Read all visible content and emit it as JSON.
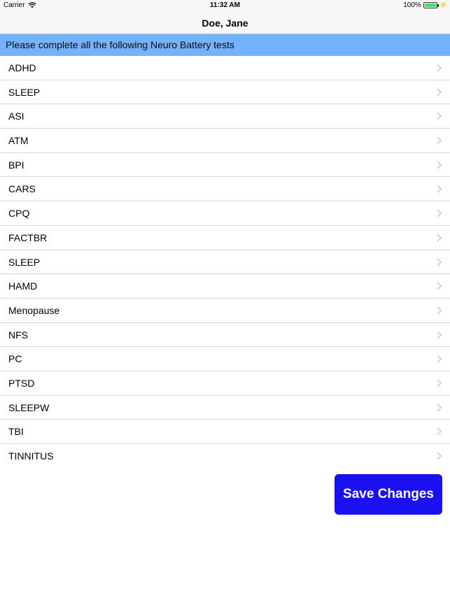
{
  "status_bar": {
    "carrier": "Carrier",
    "time": "11:32 AM",
    "battery": "100%",
    "battery_color": "#4cd964"
  },
  "nav": {
    "title": "Doe, Jane"
  },
  "banner": {
    "text": "Please complete all the following Neuro Battery tests",
    "color": "#74b3fb"
  },
  "tests": [
    {
      "label": "ADHD"
    },
    {
      "label": "SLEEP"
    },
    {
      "label": "ASI"
    },
    {
      "label": "ATM"
    },
    {
      "label": "BPI"
    },
    {
      "label": "CARS"
    },
    {
      "label": "CPQ"
    },
    {
      "label": "FACTBR"
    },
    {
      "label": "SLEEP"
    },
    {
      "label": "HAMD"
    },
    {
      "label": "Menopause"
    },
    {
      "label": "NFS"
    },
    {
      "label": "PC"
    },
    {
      "label": "PTSD"
    },
    {
      "label": "SLEEPW"
    },
    {
      "label": "TBI"
    },
    {
      "label": "TINNITUS"
    }
  ],
  "icons": {
    "row_disclosure": "chevron-right-icon",
    "wifi": "wifi-icon",
    "battery": "battery-icon",
    "charging": "bolt-icon"
  },
  "actions": {
    "save_label": "Save Changes",
    "save_color": "#1b10f0"
  }
}
